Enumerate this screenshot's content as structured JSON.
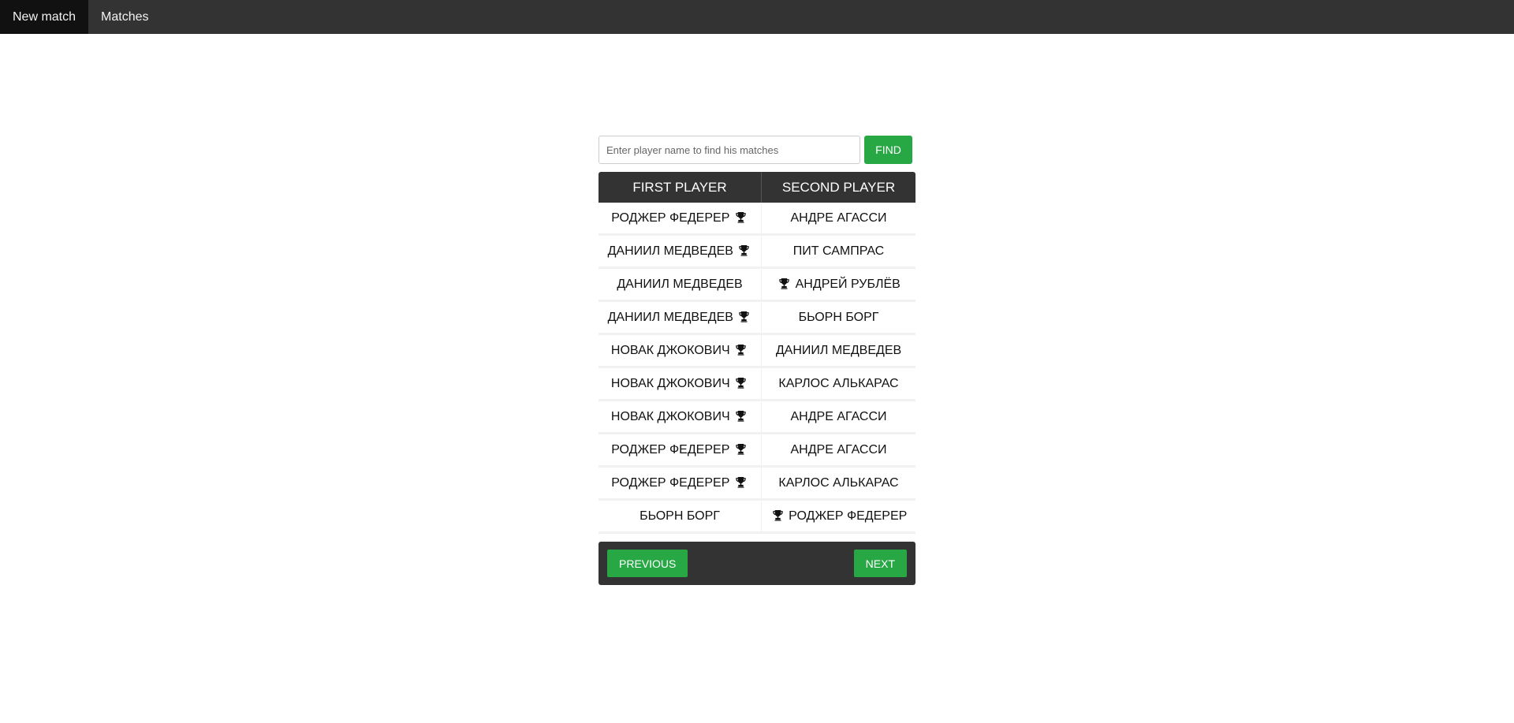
{
  "nav": {
    "items": [
      {
        "label": "New match",
        "active": true
      },
      {
        "label": "Matches",
        "active": false
      }
    ]
  },
  "search": {
    "placeholder": "Enter player name to find his matches",
    "value": "",
    "button_label": "FIND"
  },
  "table": {
    "headers": [
      "FIRST PLAYER",
      "SECOND PLAYER"
    ],
    "winner_icon": "trophy-icon",
    "rows": [
      {
        "first": "РОДЖЕР ФЕДЕРЕР",
        "second": "АНДРЕ АГАССИ",
        "winner": "first"
      },
      {
        "first": "ДАНИИЛ МЕДВЕДЕВ",
        "second": "ПИТ САМПРАС",
        "winner": "first"
      },
      {
        "first": "ДАНИИЛ МЕДВЕДЕВ",
        "second": "АНДРЕЙ РУБЛЁВ",
        "winner": "second"
      },
      {
        "first": "ДАНИИЛ МЕДВЕДЕВ",
        "second": "БЬОРН БОРГ",
        "winner": "first"
      },
      {
        "first": "НОВАК ДЖОКОВИЧ",
        "second": "ДАНИИЛ МЕДВЕДЕВ",
        "winner": "first"
      },
      {
        "first": "НОВАК ДЖОКОВИЧ",
        "second": "КАРЛОС АЛЬКАРАС",
        "winner": "first"
      },
      {
        "first": "НОВАК ДЖОКОВИЧ",
        "second": "АНДРЕ АГАССИ",
        "winner": "first"
      },
      {
        "first": "РОДЖЕР ФЕДЕРЕР",
        "second": "АНДРЕ АГАССИ",
        "winner": "first"
      },
      {
        "first": "РОДЖЕР ФЕДЕРЕР",
        "second": "КАРЛОС АЛЬКАРАС",
        "winner": "first"
      },
      {
        "first": "БЬОРН БОРГ",
        "second": "РОДЖЕР ФЕДЕРЕР",
        "winner": "second"
      }
    ]
  },
  "pager": {
    "previous_label": "PREVIOUS",
    "next_label": "NEXT"
  },
  "colors": {
    "nav_bg": "#333333",
    "nav_active_bg": "#111111",
    "accent_green": "#28a745"
  }
}
